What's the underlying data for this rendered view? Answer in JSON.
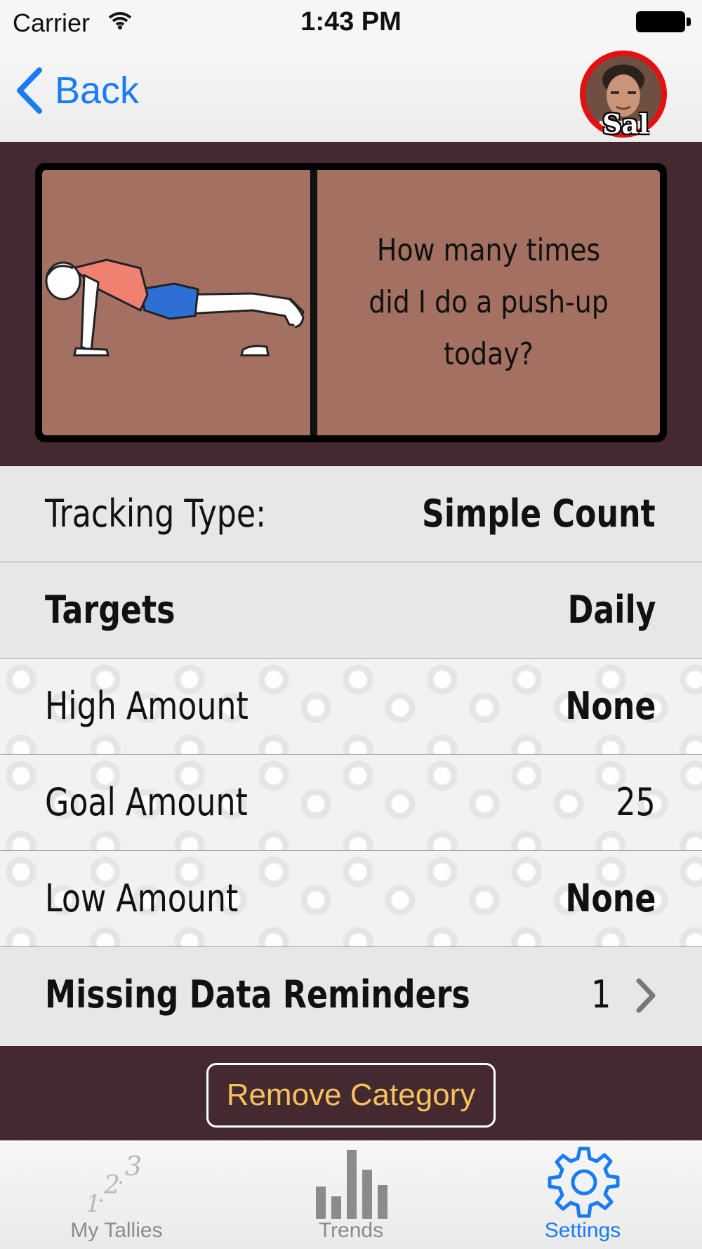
{
  "status_bar": {
    "carrier": "Carrier",
    "time": "1:43 PM"
  },
  "nav": {
    "back_label": "Back",
    "avatar_name": "Sal"
  },
  "card": {
    "question": "How many times did I do a push-up today?",
    "image": "push-up-illustration"
  },
  "rows": [
    {
      "label": "Tracking Type:",
      "value": "Simple Count"
    },
    {
      "label": "Targets",
      "value": "Daily"
    },
    {
      "label": "High Amount",
      "value": "None"
    },
    {
      "label": "Goal Amount",
      "value": "25"
    },
    {
      "label": "Low Amount",
      "value": "None"
    },
    {
      "label": "Missing Data Reminders",
      "value": "1"
    }
  ],
  "footer": {
    "remove_label": "Remove Category"
  },
  "tabs": [
    {
      "label": "My Tallies",
      "icon": "tally-icon"
    },
    {
      "label": "Trends",
      "icon": "bar-chart-icon"
    },
    {
      "label": "Settings",
      "icon": "gear-icon",
      "active": true
    }
  ],
  "colors": {
    "accent": "#1a7cf2",
    "hero_bg": "#442931",
    "card_bg": "#a37062",
    "remove_text": "#f5c25a",
    "avatar_ring": "#e41010"
  }
}
